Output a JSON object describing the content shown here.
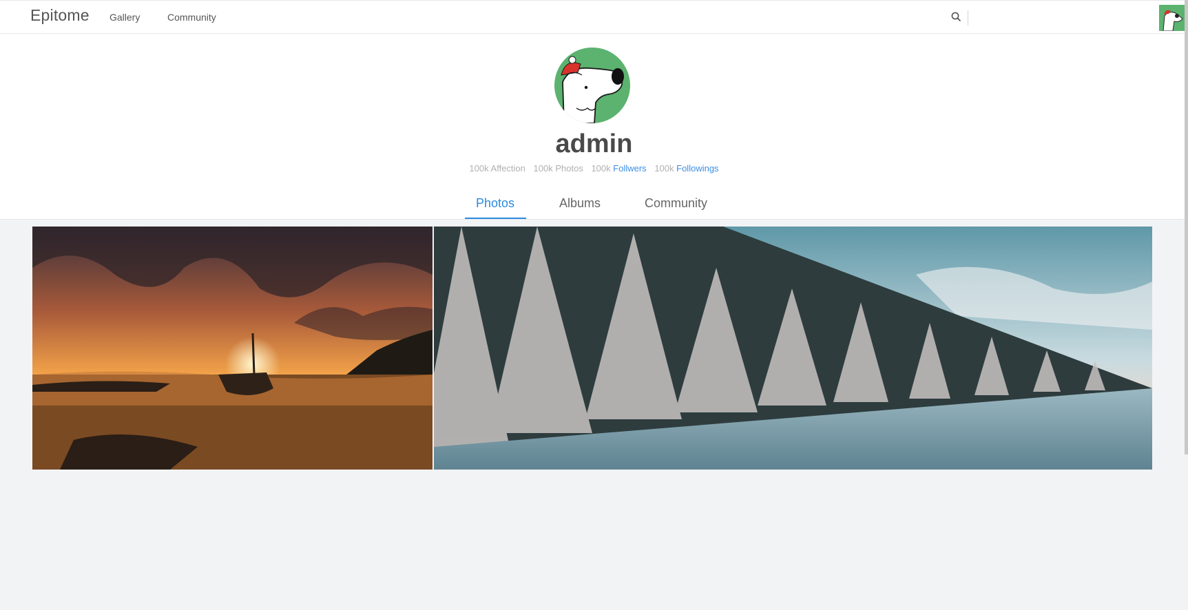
{
  "header": {
    "logo": "Epitome",
    "nav": [
      "Gallery",
      "Community"
    ],
    "search_placeholder": ""
  },
  "profile": {
    "username": "admin",
    "stats": [
      {
        "count": "100k",
        "label": "Affection",
        "link": false
      },
      {
        "count": "100k",
        "label": "Photos",
        "link": false
      },
      {
        "count": "100k",
        "label": "Follwers",
        "link": true
      },
      {
        "count": "100k",
        "label": "Followings",
        "link": true
      }
    ],
    "tabs": [
      "Photos",
      "Albums",
      "Community"
    ],
    "active_tab": "Photos"
  },
  "photos": [
    {
      "subject": "sunset boat on beach"
    },
    {
      "subject": "snowy forest"
    }
  ],
  "colors": {
    "accent": "#2b8ae0",
    "avatar_bg": "#5bb36f",
    "page_bg": "#f2f3f5"
  }
}
